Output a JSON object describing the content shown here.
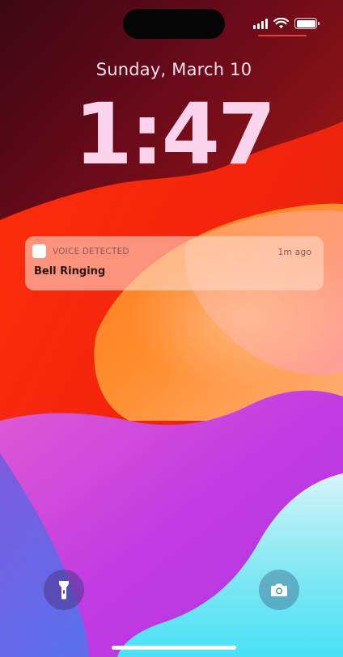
{
  "lock_screen": {
    "date": "Sunday, March 10",
    "time": "1:47"
  },
  "status_bar": {
    "icons": [
      "cellular-signal-icon",
      "wifi-icon",
      "battery-icon"
    ],
    "battery_level": 1.0,
    "accent_color": "#e2433c"
  },
  "notification": {
    "app_name": "VOICE DETECTED",
    "time_ago": "1m ago",
    "title": "Bell Ringing"
  },
  "quick_actions": {
    "left_icon": "flashlight-icon",
    "right_icon": "camera-icon"
  }
}
